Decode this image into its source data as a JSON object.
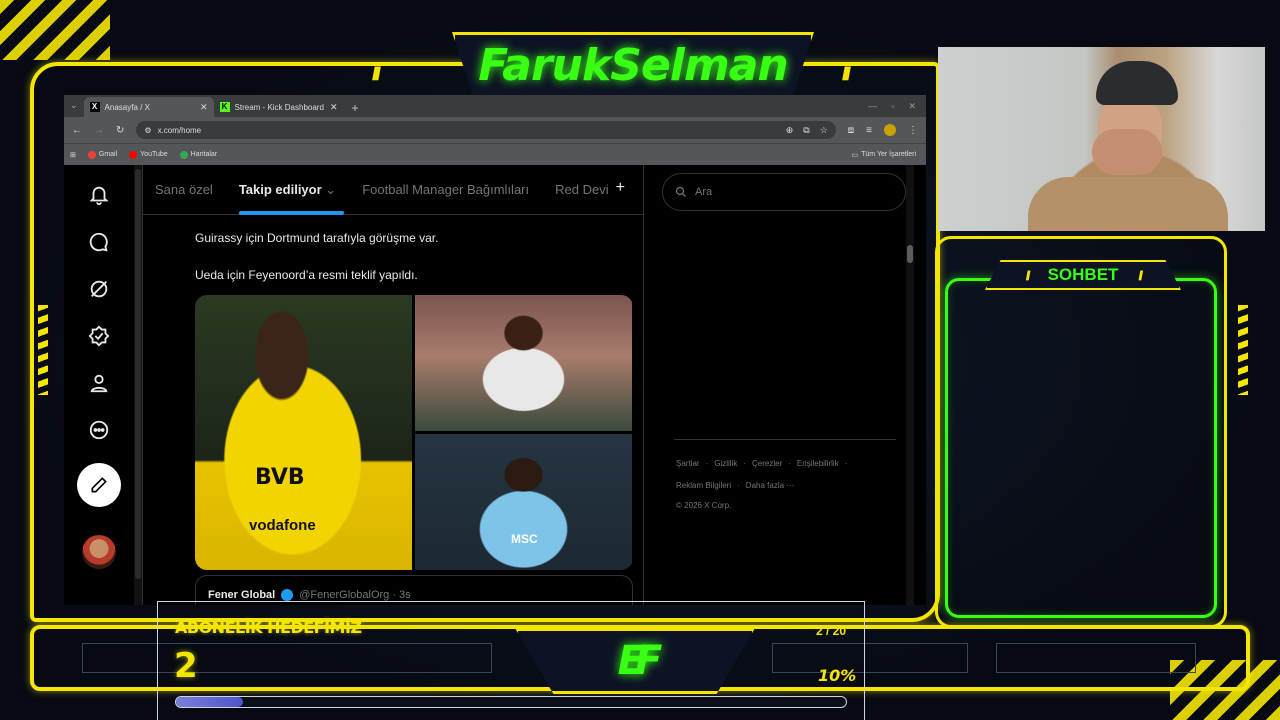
{
  "overlay": {
    "streamer_name": "FarukSelman",
    "chat_title": "SOHBET",
    "chevrons": "///",
    "goal": {
      "label": "ABONELİK HEDEFİMİZ",
      "current": "2",
      "ratio": "2 / 20",
      "percent_text": "10%",
      "progress": 0.1
    }
  },
  "browser": {
    "tabs": [
      {
        "label": "Anasayfa / X",
        "icon": "x-logo-icon",
        "active": true
      },
      {
        "label": "Stream - Kick Dashboard",
        "icon": "kick-logo-icon",
        "active": false
      }
    ],
    "url": "x.com/home",
    "bookmarks": [
      {
        "label": "Gmail",
        "color": "#ea4335"
      },
      {
        "label": "YouTube",
        "color": "#ff0000"
      },
      {
        "label": "Haritalar",
        "color": "#34a853"
      }
    ],
    "all_bookmarks": "Tüm Yer İşaretleri"
  },
  "x": {
    "tabs": [
      "Sana özel",
      "Takip ediliyor",
      "Football Manager Bağımlıları",
      "Red Devi"
    ],
    "active_tab": "Takip ediliyor",
    "tweet_lines": [
      "Guirassy için Dortmund tarafıyla görüşme var.",
      "Ueda için Feyenoord’a resmi teklif yapıldı."
    ],
    "media_text": {
      "bvb": "BVB",
      "sponsor": "vodafone",
      "msc": "MSC"
    },
    "quote": {
      "name": "Fener Global",
      "handle": "@FenerGlobalOrg · 3s"
    },
    "search_placeholder": "Ara",
    "footer": {
      "row1": [
        "Şartlar",
        "Gizlilik",
        "Çerezler",
        "Erişilebilirlik"
      ],
      "row2": [
        "Reklam Bilgileri",
        "Daha fazla ···"
      ],
      "copyright": "© 2026 X Corp."
    }
  },
  "colors": {
    "overlay_yellow": "#f4e600",
    "overlay_green": "#39ff14",
    "x_blue": "#1d9bf0"
  }
}
